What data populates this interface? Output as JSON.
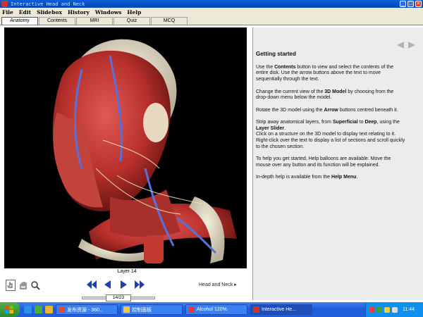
{
  "window": {
    "title": "Interactive Head and Neck",
    "controls": [
      "minimize-icon",
      "maximize-icon",
      "close-icon"
    ]
  },
  "menu": [
    "File",
    "Edit",
    "Slidebox",
    "History",
    "Windows",
    "Help"
  ],
  "tabs": [
    {
      "label": "Anatomy",
      "active": true
    },
    {
      "label": "Contents",
      "active": false
    },
    {
      "label": "MRI",
      "active": false
    },
    {
      "label": "Quiz",
      "active": false
    },
    {
      "label": "MCQ",
      "active": false
    }
  ],
  "model": {
    "layer_label": "Layer 14",
    "region_label": "Head and Neck ▸",
    "slider_value": "14/23",
    "slider_level": 0.61,
    "tools": [
      "hand-pointer-icon",
      "hand-rotate-icon",
      "magnify-icon"
    ],
    "arrows": [
      "rewind-icon",
      "previous-icon",
      "next-icon",
      "fast-forward-icon"
    ]
  },
  "help": {
    "heading": "Getting started",
    "p1_a": "Use the ",
    "p1_b": "Contents",
    "p1_c": " button to view and select the contents of the entire disk.  Use the arrow buttons above the text to move sequentially through the text.",
    "p2_a": "Change the current view of the ",
    "p2_b": "3D Model",
    "p2_c": " by choosing from the drop-down menu below the model.",
    "p3_a": "Rotate the 3D model using the ",
    "p3_b": "Arrow",
    "p3_c": " buttons centred beneath it.",
    "p4_a": "Strip away anatomical layers, from ",
    "p4_b": "Superficial",
    "p4_c": " to ",
    "p4_d": "Deep",
    "p4_e": ", using the ",
    "p4_f": "Layer Slider",
    "p4_g": ".",
    "p4_h": "Click on a structure on the 3D model to display text relating to it. Right-click over the text to display a list of sections and scroll quickly to the chosen section.",
    "p5": "To help you get started, Help balloons are available. Move the mouse over any button and its function will be explained.",
    "p6_a": "In-depth help is available from the ",
    "p6_b": "Help Menu",
    "p6_c": "."
  },
  "taskbar": {
    "tasks": [
      {
        "label": "发布资源 - 360...",
        "icon": "browser-icon"
      },
      {
        "label": "控制面板",
        "icon": "folder-icon"
      },
      {
        "label": "Alcohol 120%",
        "icon": "alcohol-icon"
      },
      {
        "label": "Interactive He...",
        "icon": "app-icon",
        "active": true
      }
    ],
    "clock": "11:44"
  },
  "colors": {
    "titlebar": "#0a5fd8",
    "taskbar": "#245edb",
    "panel_bg": "#ececec"
  }
}
